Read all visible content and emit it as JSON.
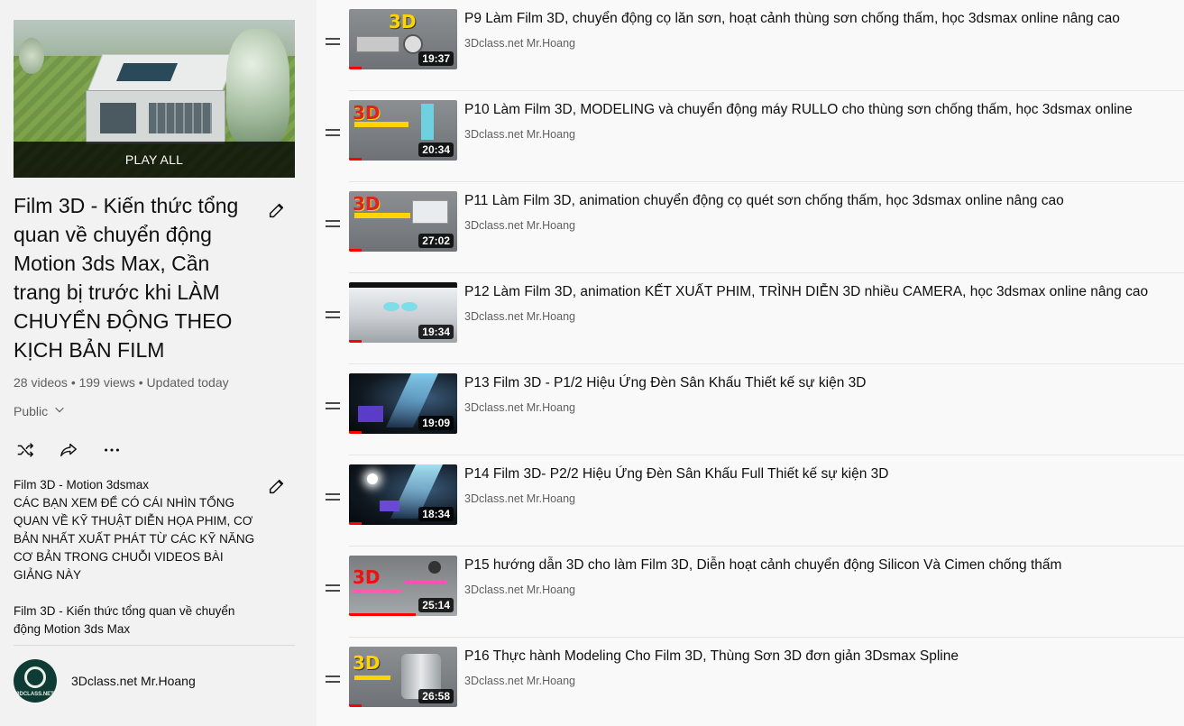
{
  "playlist": {
    "play_all_label": "PLAY ALL",
    "title": "Film 3D - Kiến thức tổng quan về chuyển động Motion 3ds Max, Cần trang bị trước khi LÀM CHUYỂN ĐỘNG THEO KỊCH BẢN FILM",
    "meta": "28 videos • 199 views • Updated today",
    "privacy": "Public",
    "description_lines": [
      "Film 3D - Motion 3dsmax",
      "CÁC BẠN XEM ĐỂ CÓ CÁI NHÌN TỔNG QUAN VỀ KỸ THUẬT DIỄN HỌA PHIM, CƠ BẢN NHẤT XUẤT PHÁT TỪ CÁC KỸ NĂNG CƠ BẢN TRONG CHUỖI VIDEOS BÀI GIẢNG NÀY",
      "Film 3D - Kiến thức tổng quan về chuyển động Motion 3ds Max"
    ],
    "owner": {
      "name": "3Dclass.net Mr.Hoang",
      "avatar_text": "3DCLASS.NET"
    },
    "icons": {
      "edit": "pencil-icon",
      "privacy_dropdown": "chevron-down-icon",
      "shuffle": "shuffle-icon",
      "share": "share-icon",
      "more": "more-horizontal-icon"
    }
  },
  "videos": [
    {
      "title": "P9 Làm Film 3D, chuyển động cọ lăn sơn, hoạt cảnh thùng sơn chống thấm, học 3dsmax online nâng cao",
      "channel": "3Dclass.net Mr.Hoang",
      "duration": "19:37",
      "progress": 0.12
    },
    {
      "title": "P10 Làm Film 3D, MODELING và chuyển động máy RULLO cho thùng sơn chống thấm, học 3dsmax online",
      "channel": "3Dclass.net Mr.Hoang",
      "duration": "20:34",
      "progress": 0.12
    },
    {
      "title": "P11 Làm Film 3D, animation chuyển động cọ quét sơn chống thấm, học 3dsmax online nâng cao",
      "channel": "3Dclass.net Mr.Hoang",
      "duration": "27:02",
      "progress": 0.12
    },
    {
      "title": "P12 Làm Film 3D, animation KẾT XUẤT PHIM, TRÌNH DIỄN 3D nhiều CAMERA, học 3dsmax online nâng cao",
      "channel": "3Dclass.net Mr.Hoang",
      "duration": "19:34",
      "progress": 0.12
    },
    {
      "title": "P13 Film 3D - P1/2 Hiệu Ứng Đèn Sân Khấu Thiết kế sự kiện 3D",
      "channel": "3Dclass.net Mr.Hoang",
      "duration": "19:09",
      "progress": 0.12
    },
    {
      "title": "P14 Film 3D- P2/2 Hiệu Ứng Đèn Sân Khấu Full Thiết kế sự kiện 3D",
      "channel": "3Dclass.net Mr.Hoang",
      "duration": "18:34",
      "progress": 0.12
    },
    {
      "title": "P15 hướng dẫn 3D cho làm Film 3D, Diễn hoạt cảnh chuyển động Silicon Và Cimen chống thấm",
      "channel": "3Dclass.net Mr.Hoang",
      "duration": "25:14",
      "progress": 0.62
    },
    {
      "title": "P16 Thực hành Modeling Cho Film 3D, Thùng Sơn 3D đơn giản 3Dsmax Spline",
      "channel": "3Dclass.net Mr.Hoang",
      "duration": "26:58",
      "progress": 0.12
    }
  ],
  "colors": {
    "accent_red": "#ff0000",
    "panel_bg": "#f2f2f2",
    "text_secondary": "#606060"
  },
  "icons": {
    "drag_handle": "drag-handle-icon"
  }
}
